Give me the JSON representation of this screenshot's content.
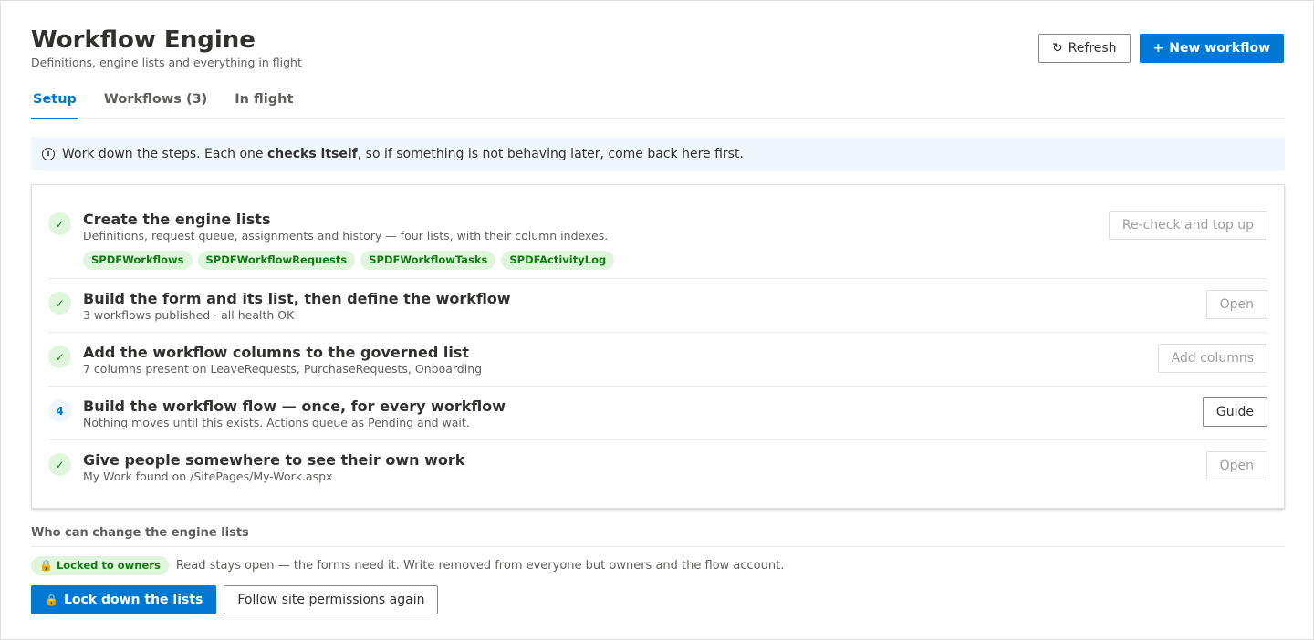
{
  "header": {
    "title": "Workflow Engine",
    "subtitle": "Definitions, engine lists and everything in flight",
    "refresh_icon": "↻",
    "refresh_label": "Refresh",
    "new_icon": "+",
    "new_label": "New workflow"
  },
  "tabs": [
    {
      "label": "Setup",
      "active": true
    },
    {
      "label": "Workflows (3)",
      "active": false
    },
    {
      "label": "In flight",
      "active": false
    }
  ],
  "info": {
    "icon": "i",
    "text_before": "Work down the steps. Each one ",
    "text_bold": "checks itself",
    "text_after": ", so if something is not behaving later, come back here first."
  },
  "steps": [
    {
      "status": "done",
      "badge": "✓",
      "title": "Create the engine lists",
      "desc": "Definitions, request queue, assignments and history — four lists, with their column indexes.",
      "chips": [
        "SPDFWorkflows",
        "SPDFWorkflowRequests",
        "SPDFWorkflowTasks",
        "SPDFActivityLog"
      ],
      "action": "Re-check and top up",
      "action_enabled": false
    },
    {
      "status": "done",
      "badge": "✓",
      "title": "Build the form and its list, then define the workflow",
      "desc": "3 workflows published · all health OK",
      "action": "Open",
      "action_enabled": false
    },
    {
      "status": "done",
      "badge": "✓",
      "title": "Add the workflow columns to the governed list",
      "desc": "7 columns present on LeaveRequests, PurchaseRequests, Onboarding",
      "action": "Add columns",
      "action_enabled": false
    },
    {
      "status": "current",
      "badge": "4",
      "title": "Build the workflow flow — once, for every workflow",
      "desc": "Nothing moves until this exists. Actions queue as Pending and wait.",
      "action": "Guide",
      "action_enabled": true
    },
    {
      "status": "done",
      "badge": "✓",
      "title": "Give people somewhere to see their own work",
      "desc": "My Work found on /SitePages/My-Work.aspx",
      "action": "Open",
      "action_enabled": false
    }
  ],
  "permissions": {
    "section_title": "Who can change the engine lists",
    "badge_icon": "🔒",
    "badge_label": "Locked to owners",
    "description": "Read stays open — the forms need it. Write removed from everyone but owners and the flow account.",
    "lock_icon": "🔒",
    "lock_button": "Lock down the lists",
    "follow_button": "Follow site permissions again"
  },
  "colors": {
    "accent": "#0078d4",
    "success_bg": "#dff6dd",
    "success_fg": "#107c10",
    "info_bg": "#eff6fc"
  }
}
